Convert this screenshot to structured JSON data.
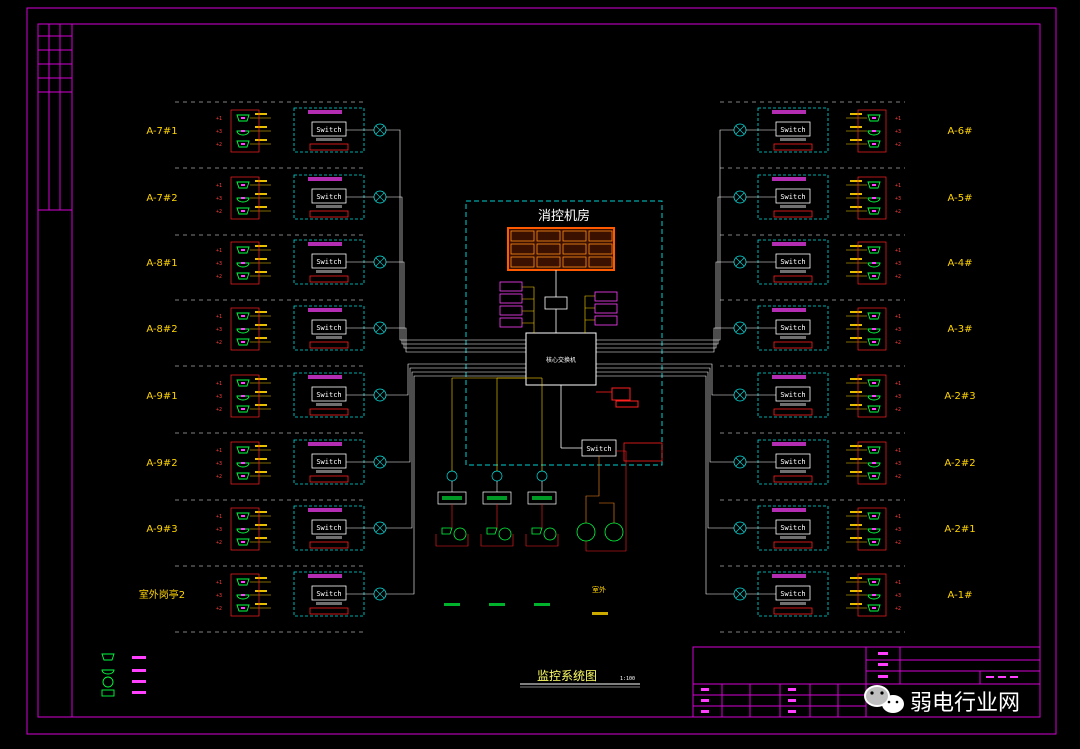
{
  "diagram": {
    "control_room_title": "消控机房",
    "core_switch_label": "核心交换机",
    "switch_label": "Switch",
    "title": "监控系统图",
    "scale": "1:100",
    "outdoor_label": "室外",
    "left_rows": [
      {
        "label": "A-7#1"
      },
      {
        "label": "A-7#2"
      },
      {
        "label": "A-8#1"
      },
      {
        "label": "A-8#2"
      },
      {
        "label": "A-9#1"
      },
      {
        "label": "A-9#2"
      },
      {
        "label": "A-9#3"
      },
      {
        "label": "室外岗亭2"
      }
    ],
    "right_rows": [
      {
        "label": "A-6#"
      },
      {
        "label": "A-5#"
      },
      {
        "label": "A-4#"
      },
      {
        "label": "A-3#"
      },
      {
        "label": "A-2#3"
      },
      {
        "label": "A-2#2"
      },
      {
        "label": "A-2#1"
      },
      {
        "label": "A-1#"
      }
    ]
  },
  "watermark": {
    "text": "弱电行业网"
  },
  "colors": {
    "frame": "#d400d4",
    "cyan": "#00e0e0",
    "green": "#00ff40",
    "red": "#ff2020",
    "yellow": "#ffd400",
    "white": "#ffffff",
    "orange": "#ff8c1a"
  }
}
